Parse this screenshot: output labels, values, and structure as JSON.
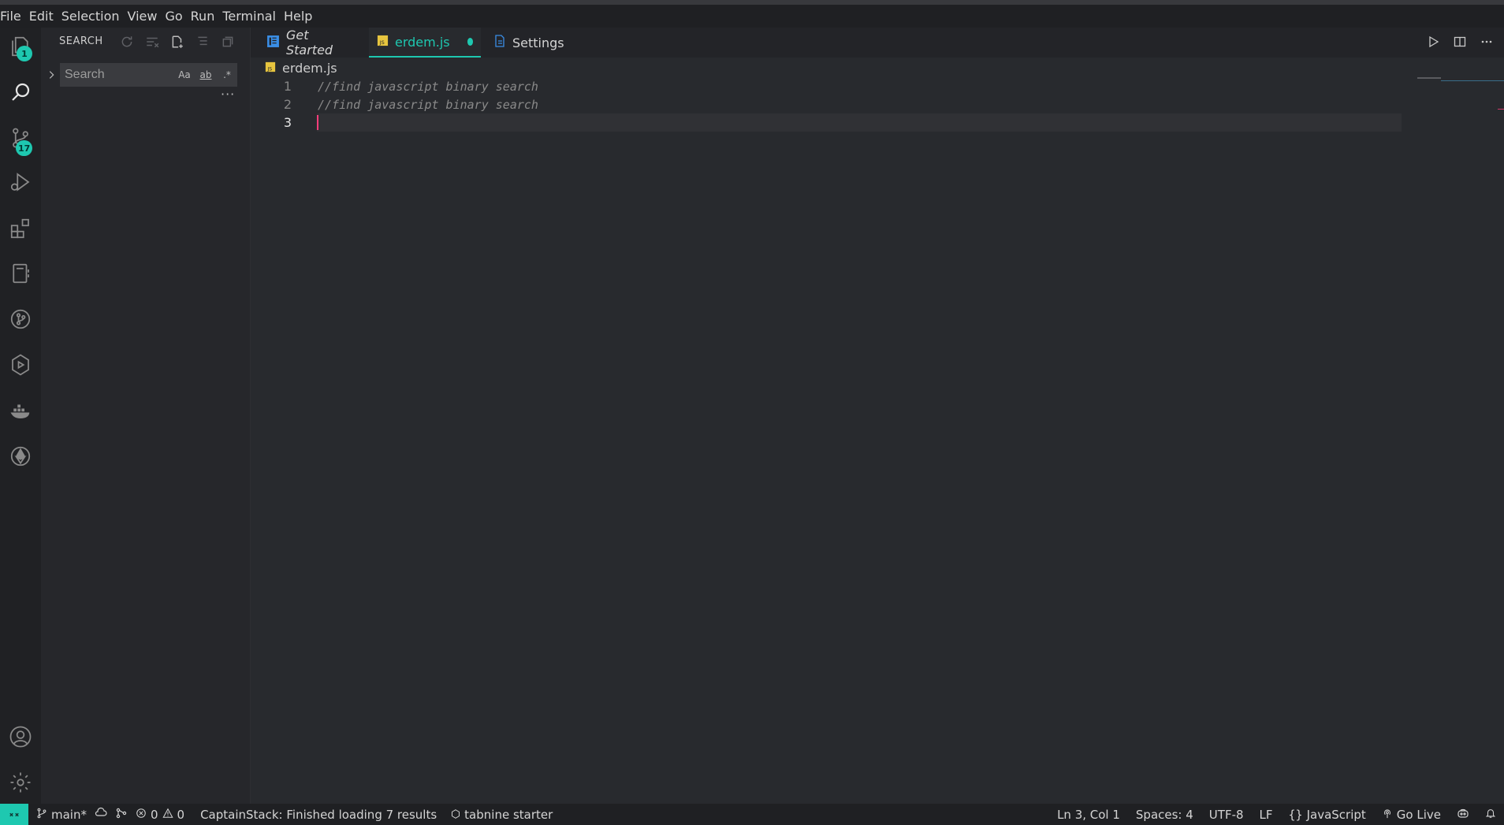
{
  "menu": [
    "File",
    "Edit",
    "Selection",
    "View",
    "Go",
    "Run",
    "Terminal",
    "Help"
  ],
  "activity_bar": {
    "explorer_badge": "1",
    "scm_badge": "17"
  },
  "sidebar": {
    "title": "SEARCH",
    "search_placeholder": "Search",
    "opt_case": "Aa",
    "opt_word": "ab",
    "opt_regex": ".*",
    "more": "···"
  },
  "tabs": [
    {
      "label": "Get Started"
    },
    {
      "label": "erdem.js"
    },
    {
      "label": "Settings"
    }
  ],
  "breadcrumb": {
    "file": "erdem.js"
  },
  "editor": {
    "lines": [
      {
        "num": "1",
        "text": "//find javascript binary search"
      },
      {
        "num": "2",
        "text": "//find javascript binary search"
      },
      {
        "num": "3",
        "text": ""
      }
    ]
  },
  "status": {
    "branch": "main*",
    "errors": "0",
    "warnings": "0",
    "message": "CaptainStack: Finished loading 7 results",
    "tabnine": "tabnine starter",
    "position": "Ln 3, Col 1",
    "spaces": "Spaces: 4",
    "encoding": "UTF-8",
    "eol": "LF",
    "language": "JavaScript",
    "golive": "Go Live"
  },
  "colors": {
    "accent": "#1ec8b0",
    "cursor": "#ff3d7a",
    "background": "#282a2e"
  }
}
